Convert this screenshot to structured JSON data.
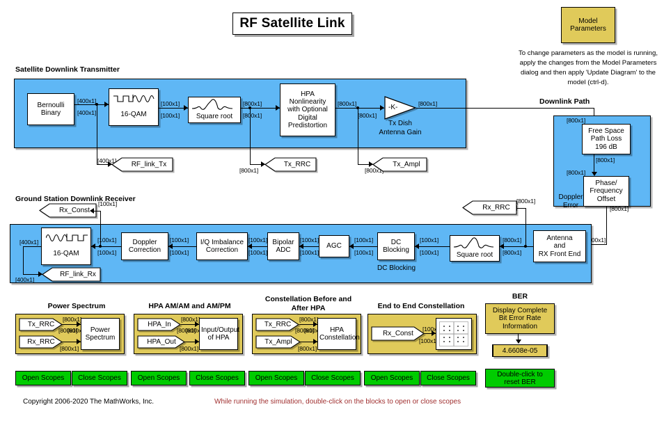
{
  "title": "RF Satellite Link",
  "model_parameters": {
    "label_line1": "Model",
    "label_line2": "Parameters",
    "note": "To change parameters as the model is running, apply the changes from the Model Parameters dialog and then apply 'Update Diagram' to the model (ctrl-d)."
  },
  "headings": {
    "transmitter": "Satellite Downlink Transmitter",
    "downlink_path": "Downlink Path",
    "receiver": "Ground Station Downlink Receiver",
    "power_spectrum": "Power Spectrum",
    "hpa_amam": "HPA AM/AM and AM/PM",
    "constellation_before_after": "Constellation Before and After HPA",
    "constellation_before_after_l1": "Constellation Before and",
    "constellation_before_after_l2": "After HPA",
    "end_to_end": "End to End Constellation",
    "ber": "BER"
  },
  "transmitter": {
    "bernoulli": "Bernoulli Binary",
    "bernoulli_l1": "Bernoulli",
    "bernoulli_l2": "Binary",
    "qam": "16-QAM",
    "rrc": "Square root",
    "hpa_l1": "HPA",
    "hpa_l2": "Nonlinearity",
    "hpa_l3": "with Optional",
    "hpa_l4": "Digital",
    "hpa_l5": "Predistortion",
    "gain_symbol": "-K-",
    "gain_label_l1": "Tx Dish",
    "gain_label_l2": "Antenna Gain",
    "tags": {
      "rf_link_tx": "RF_link_Tx",
      "tx_rrc": "Tx_RRC",
      "tx_ampl": "Tx_Ampl"
    },
    "dims": {
      "d400": "[400x1]",
      "d100": "[100x1]",
      "d800": "[800x1]"
    }
  },
  "downlink": {
    "doppler_l1": "Doppler",
    "doppler_l2": "Error",
    "fspl_l1": "Free Space",
    "fspl_l2": "Path Loss",
    "fspl_l3": "196 dB",
    "offset_l1": "Phase/",
    "offset_l2": "Frequency",
    "offset_l3": "Offset",
    "dim": "[800x1]"
  },
  "receiver": {
    "qam": "16-QAM",
    "doppler_l1": "Doppler",
    "doppler_l2": "Correction",
    "iq_l1": "I/Q Imbalance",
    "iq_l2": "Correction",
    "adc_l1": "Bipolar",
    "adc_l2": "ADC",
    "agc": "AGC",
    "dcb_l1": "DC",
    "dcb_l2": "Blocking",
    "dcb_caption": "DC Blocking",
    "rrc": "Square root",
    "antenna_l1": "Antenna",
    "antenna_l2": "and",
    "antenna_l3": "RX Front End",
    "tags": {
      "rx_const": "Rx_Const",
      "rf_link_rx": "RF_link_Rx",
      "rx_rrc": "Rx_RRC"
    },
    "dims": {
      "d400": "[400x1]",
      "d100": "[100x1]",
      "d800": "[800x1]"
    }
  },
  "scopes": {
    "power_spectrum": {
      "from1": "Tx_RRC",
      "from2": "Rx_RRC",
      "block_l1": "Power",
      "block_l2": "Spectrum",
      "dim": "[800x1]"
    },
    "hpa": {
      "from1": "HPA_In",
      "from2": "HPA_Out",
      "block_l1": "Input/Output",
      "block_l2": "of HPA",
      "dim": "[800x1]"
    },
    "constellation": {
      "from1": "Tx_RRC",
      "from2": "Tx_Ampl",
      "block_l1": "HPA",
      "block_l2": "Constellation",
      "dim": "[800x1]"
    },
    "end_to_end": {
      "from1": "Rx_Const",
      "dim": "[100x1]"
    }
  },
  "ber": {
    "block_l1": "Display Complete",
    "block_l2": "Bit Error Rate",
    "block_l3": "Information",
    "value": "4.6608e-05",
    "reset_l1": "Double-click to",
    "reset_l2": "reset BER"
  },
  "buttons": {
    "open": "Open Scopes",
    "close": "Close Scopes"
  },
  "footer": {
    "copyright": "Copyright 2006-2020 The MathWorks, Inc.",
    "hint": "While running the simulation, double-click on the blocks to open or close  scopes"
  },
  "colors": {
    "subsystem_blue": "#5FB7F5",
    "scope_yellow": "#E0CA5A",
    "button_green": "#00CC00",
    "hint_red": "#A03030"
  }
}
